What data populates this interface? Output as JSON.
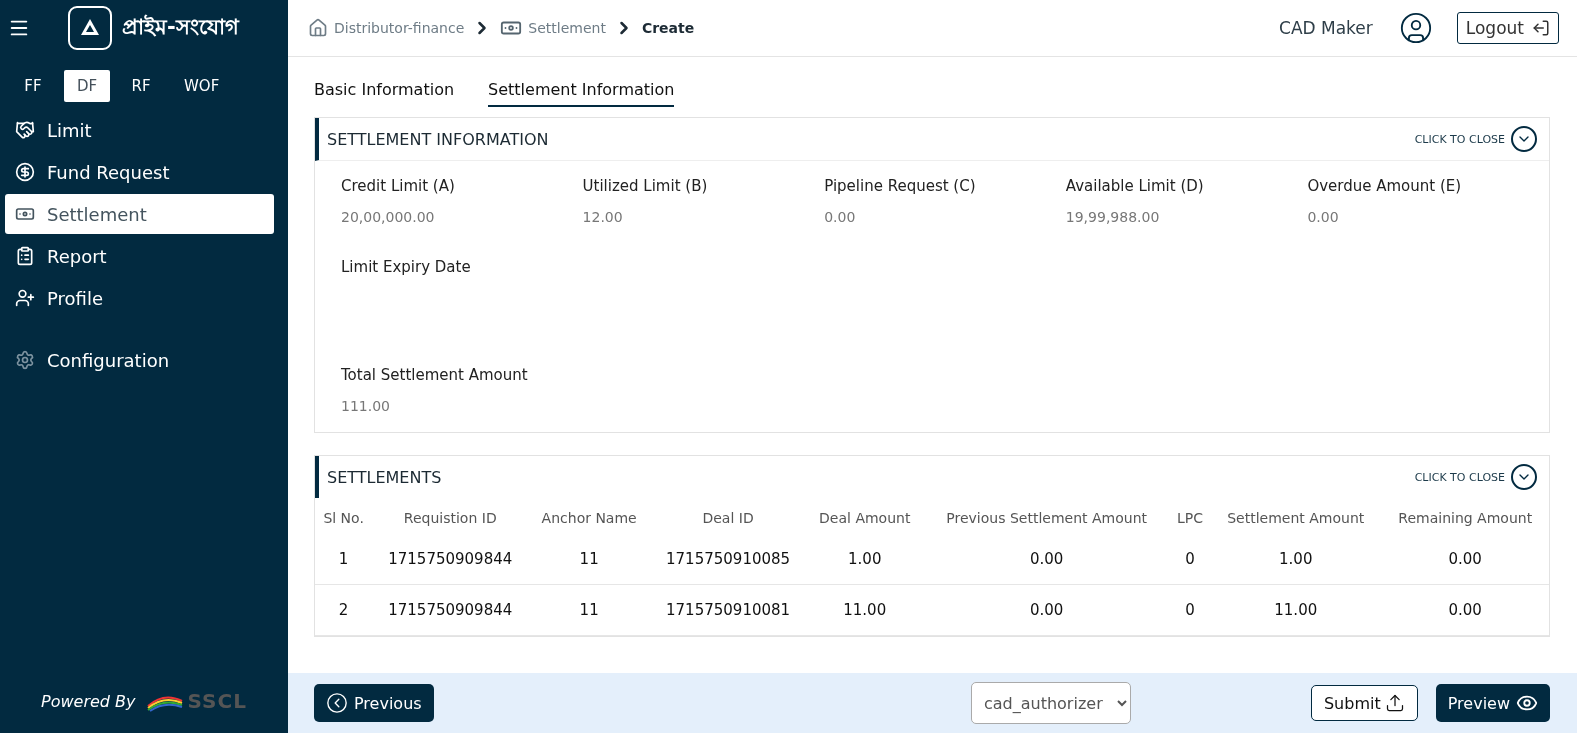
{
  "brand": {
    "name": "প্রাইম-সংযোগ"
  },
  "product_tabs": [
    {
      "label": "FF",
      "selected": false
    },
    {
      "label": "DF",
      "selected": true
    },
    {
      "label": "RF",
      "selected": false
    },
    {
      "label": "WOF",
      "selected": false
    }
  ],
  "sidebar": {
    "items": [
      {
        "label": "Limit",
        "kind": "handshake",
        "selected": false
      },
      {
        "label": "Fund Request",
        "kind": "fund",
        "selected": false
      },
      {
        "label": "Settlement",
        "kind": "money",
        "selected": true
      },
      {
        "label": "Report",
        "kind": "report",
        "selected": false
      },
      {
        "label": "Profile",
        "kind": "profile",
        "selected": false
      },
      {
        "label": "Configuration",
        "kind": "gear",
        "selected": false
      }
    ],
    "powered_by": "Powered By",
    "powered_logo": "SSCL"
  },
  "breadcrumb": [
    {
      "label": "Distributor-finance",
      "kind": "home"
    },
    {
      "label": "Settlement",
      "kind": "money"
    },
    {
      "label": "Create",
      "kind": "current"
    }
  ],
  "user": {
    "name": "CAD Maker",
    "logout": "Logout"
  },
  "tabs": [
    {
      "label": "Basic Information",
      "selected": false
    },
    {
      "label": "Settlement Information",
      "selected": true
    }
  ],
  "settlement_information": {
    "title": "SETTLEMENT INFORMATION",
    "toggle": "CLICK TO CLOSE",
    "fields": [
      {
        "label": "Credit Limit (A)",
        "value": "20,00,000.00"
      },
      {
        "label": "Utilized Limit (B)",
        "value": "12.00"
      },
      {
        "label": "Pipeline Request (C)",
        "value": "0.00"
      },
      {
        "label": "Available Limit (D)",
        "value": "19,99,988.00"
      },
      {
        "label": "Overdue Amount (E)",
        "value": "0.00"
      }
    ],
    "expiry_label": "Limit Expiry Date",
    "total_label": "Total Settlement Amount",
    "total_value": "111.00"
  },
  "settlements": {
    "title": "SETTLEMENTS",
    "toggle": "CLICK TO CLOSE",
    "columns": [
      "Sl No.",
      "Requistion ID",
      "Anchor Name",
      "Deal ID",
      "Deal Amount",
      "Previous Settlement Amount",
      "LPC",
      "Settlement Amount",
      "Remaining Amount"
    ],
    "rows": [
      [
        "1",
        "1715750909844",
        "11",
        "1715750910085",
        "1.00",
        "0.00",
        "0",
        "1.00",
        "0.00"
      ],
      [
        "2",
        "1715750909844",
        "11",
        "1715750910081",
        "11.00",
        "0.00",
        "0",
        "11.00",
        "0.00"
      ]
    ]
  },
  "footer": {
    "previous": "Previous",
    "select_value": "cad_authorizer",
    "submit": "Submit",
    "preview": "Preview"
  }
}
